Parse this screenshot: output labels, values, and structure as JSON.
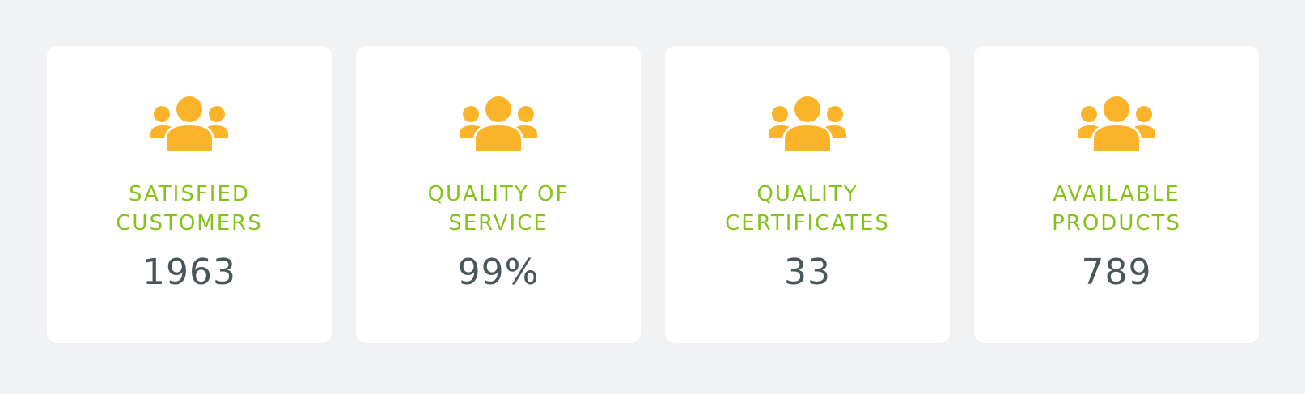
{
  "colors": {
    "background": "#f1f2f4",
    "card": "#ffffff",
    "icon": "#fbb42a",
    "label": "#86c21b",
    "value": "#4a5659"
  },
  "stats": [
    {
      "icon": "users-group-icon",
      "label_line1": "SATISFIED",
      "label_line2": "CUSTOMERS",
      "value": "1963"
    },
    {
      "icon": "users-group-icon",
      "label_line1": "QUALITY OF",
      "label_line2": "SERVICE",
      "value": "99%"
    },
    {
      "icon": "users-group-icon",
      "label_line1": "QUALITY",
      "label_line2": "CERTIFICATES",
      "value": "33"
    },
    {
      "icon": "users-group-icon",
      "label_line1": "AVAILABLE",
      "label_line2": "PRODUCTS",
      "value": "789"
    }
  ]
}
